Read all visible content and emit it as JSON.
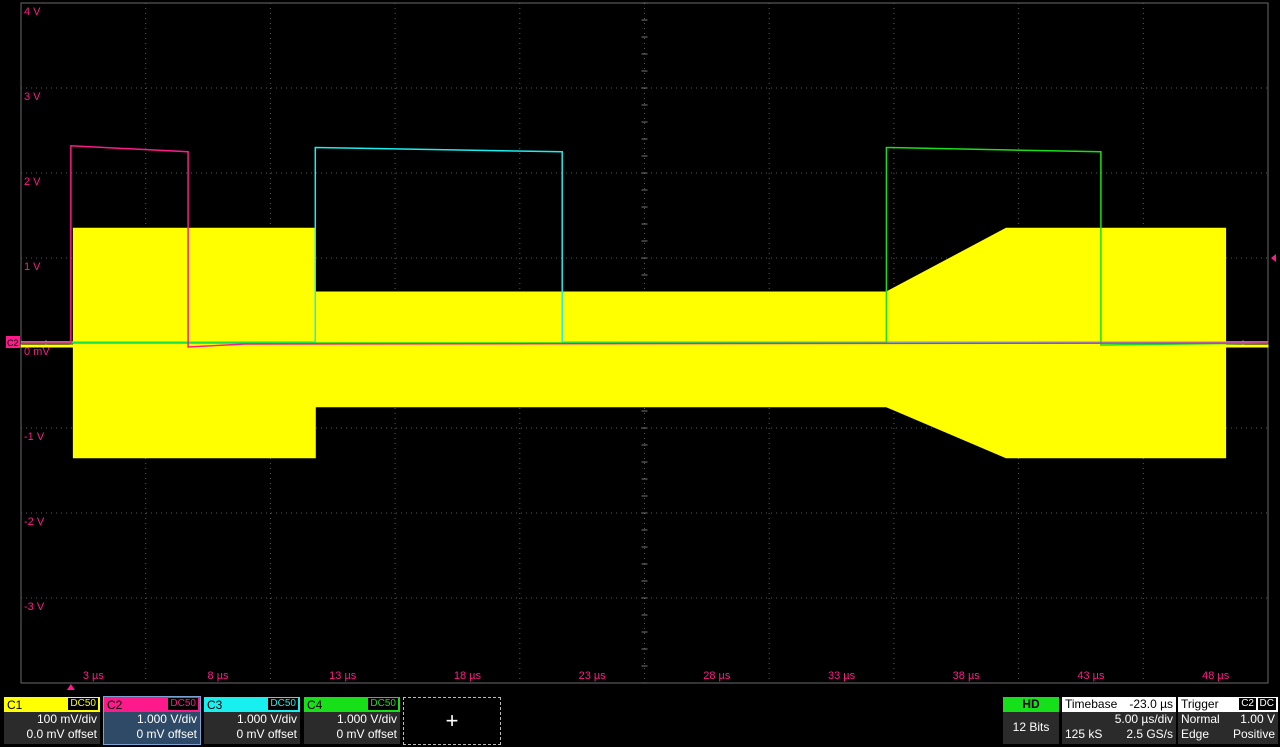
{
  "colors": {
    "c1": "#ffff00",
    "c2": "#ff1a8c",
    "c3": "#18f0f0",
    "c4": "#18e018",
    "grid": "#5a5a5a",
    "label": "#ff1a8c"
  },
  "y_labels": [
    "4 V",
    "3 V",
    "2 V",
    "1 V",
    "0 mV",
    "-1 V",
    "-2 V",
    "-3 V"
  ],
  "x_labels": [
    "3 µs",
    "8 µs",
    "13 µs",
    "18 µs",
    "23 µs",
    "28 µs",
    "33 µs",
    "38 µs",
    "43 µs",
    "48 µs"
  ],
  "marker_label": "C2",
  "channels": [
    {
      "name": "C1",
      "coupling": "DC50",
      "scale": "100 mV/div",
      "offset": "0.0 mV offset",
      "color": "#ffff00",
      "text": "#000"
    },
    {
      "name": "C2",
      "coupling": "DC50",
      "scale": "1.000 V/div",
      "offset": "0 mV offset",
      "color": "#ff1a8c",
      "text": "#000",
      "selected": true
    },
    {
      "name": "C3",
      "coupling": "DC50",
      "scale": "1.000 V/div",
      "offset": "0 mV offset",
      "color": "#18f0f0",
      "text": "#000"
    },
    {
      "name": "C4",
      "coupling": "DC50",
      "scale": "1.000 V/div",
      "offset": "0 mV offset",
      "color": "#18e018",
      "text": "#000"
    }
  ],
  "add_channel": "+",
  "hd": {
    "label": "HD",
    "bits": "12 Bits"
  },
  "timebase": {
    "label": "Timebase",
    "delay": "-23.0 µs",
    "per_div": "5.00 µs/div",
    "samples": "125 kS",
    "rate": "2.5 GS/s"
  },
  "trigger": {
    "label": "Trigger",
    "source": "C2",
    "coupling": "DC",
    "mode": "Normal",
    "level": "1.00 V",
    "type": "Edge",
    "slope": "Positive"
  }
}
